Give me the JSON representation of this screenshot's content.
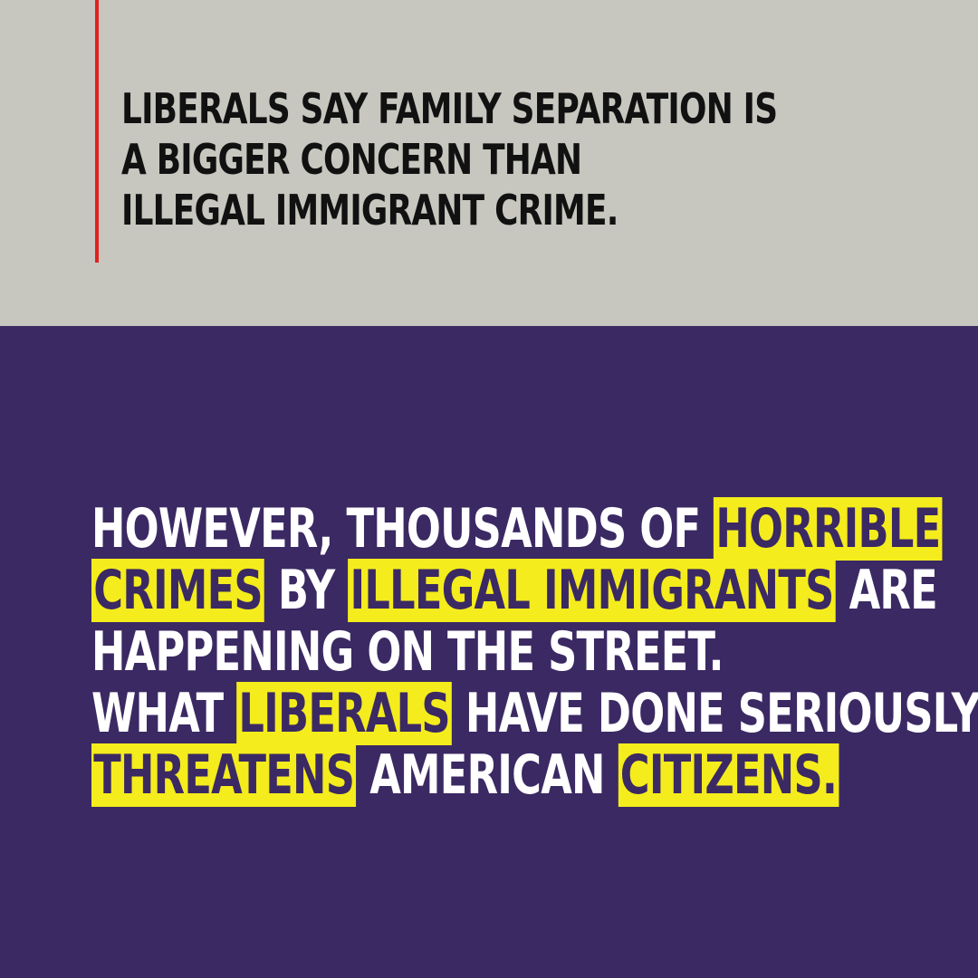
{
  "colors": {
    "top_background": "#c7c7c0",
    "bottom_background": "#3b2963",
    "accent": "#e0221b",
    "highlight": "#f4ec1c",
    "headline_text": "#111111",
    "body_text": "#ffffff"
  },
  "headline": {
    "lines": [
      "LIBERALS SAY FAMILY SEPARATION IS",
      "A BIGGER CONCERN THAN",
      "ILLEGAL IMMIGRANT CRIME."
    ]
  },
  "body": {
    "line1": {
      "pre": "HOWEVER, THOUSANDS OF ",
      "hl": "HORRIBLE"
    },
    "line2": {
      "hl1": "CRIMES",
      "mid": " BY ",
      "hl2": "ILLEGAL IMMIGRANTS",
      "post": " ARE"
    },
    "line3": {
      "text": "HAPPENING ON THE STREET."
    },
    "line4": {
      "pre": "WHAT ",
      "hl": "LIBERALS",
      "post": " HAVE DONE SERIOUSLY"
    },
    "line5": {
      "hl1": "THREATENS",
      "mid": " AMERICAN ",
      "hl2": "CITIZENS."
    }
  }
}
